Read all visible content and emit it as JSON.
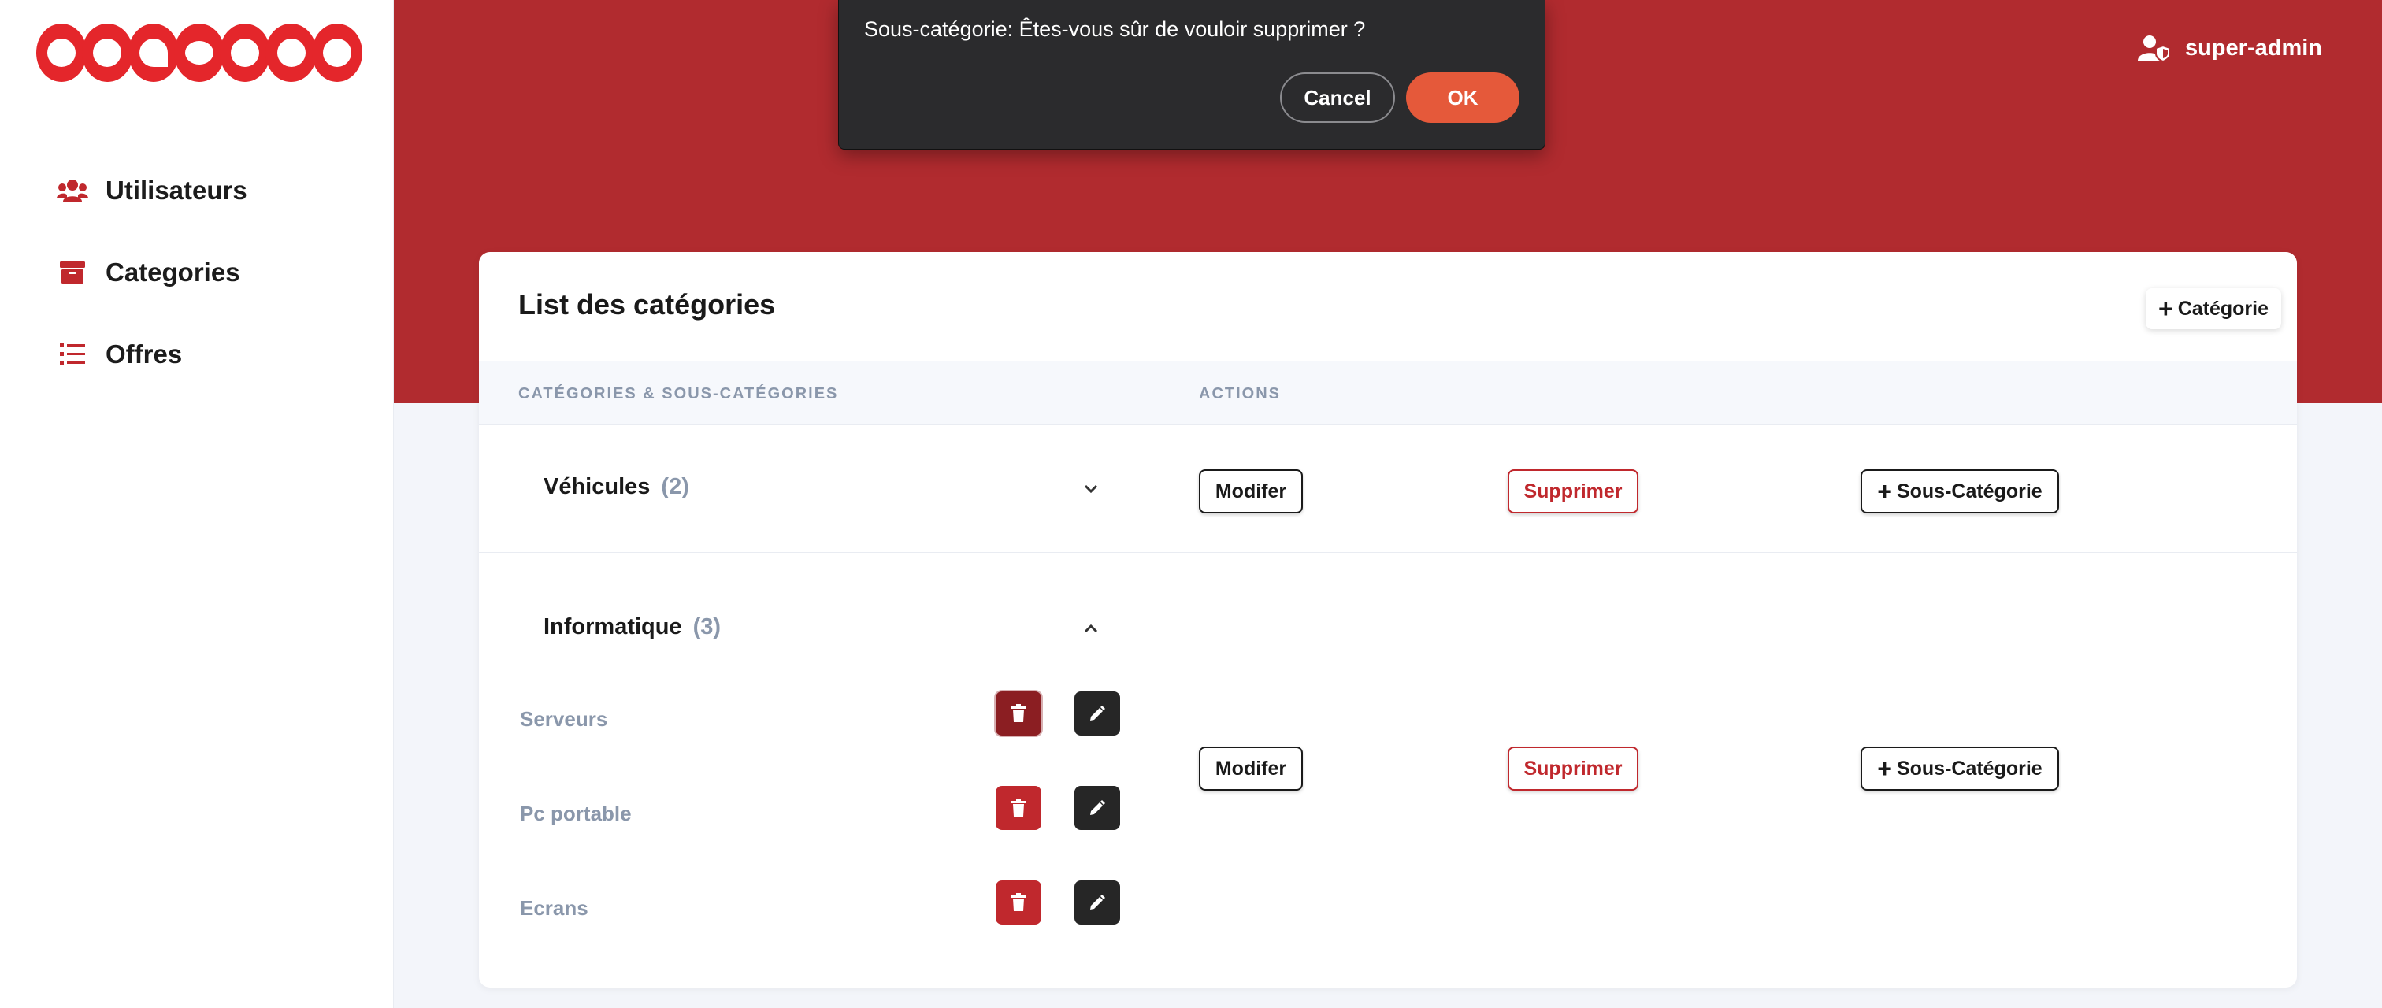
{
  "sidebar": {
    "brand": "ooredoo",
    "items": [
      {
        "label": "Utilisateurs",
        "icon": "users-icon"
      },
      {
        "label": "Categories",
        "icon": "archive-box-icon"
      },
      {
        "label": "Offres",
        "icon": "list-icon"
      }
    ]
  },
  "header": {
    "user": "super-admin",
    "user_icon": "user-shield-icon"
  },
  "dialog": {
    "message": "Sous-catégorie: Êtes-vous sûr de vouloir supprimer ?",
    "cancel": "Cancel",
    "ok": "OK"
  },
  "card": {
    "title": "List des catégories",
    "add_button": "Catégorie",
    "columns": [
      "CATÉGORIES & SOUS-CATÉGORIES",
      "ACTIONS"
    ],
    "categories": [
      {
        "name": "Véhicules",
        "count": "(2)",
        "expanded": false,
        "actions": {
          "edit": "Modifer",
          "delete": "Supprimer",
          "add_sub": "Sous-Catégorie"
        }
      },
      {
        "name": "Informatique",
        "count": "(3)",
        "expanded": true,
        "subcategories": [
          "Serveurs",
          "Pc portable",
          "Ecrans"
        ],
        "actions": {
          "edit": "Modifer",
          "delete": "Supprimer",
          "add_sub": "Sous-Catégorie"
        }
      }
    ]
  },
  "colors": {
    "brand_red": "#b12b2f",
    "logo_red": "#e4262b",
    "danger": "#c0282d",
    "ok_button": "#e5593a",
    "muted_text": "#8a97ab"
  }
}
